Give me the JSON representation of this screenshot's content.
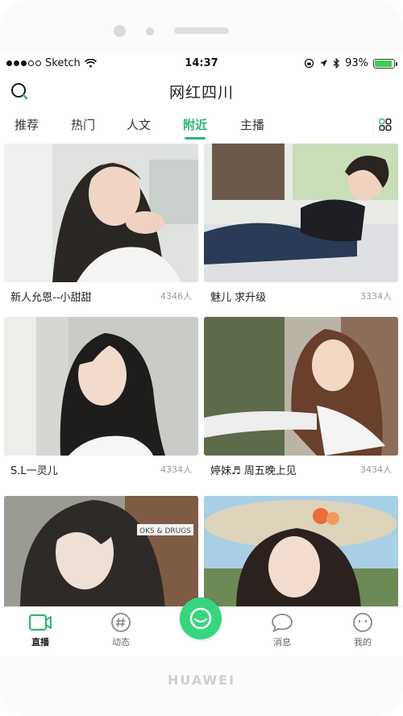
{
  "status_bar": {
    "carrier": "Sketch",
    "time": "14:37",
    "battery_percent": "93%",
    "battery_level": 0.93
  },
  "header": {
    "title": "网红四川"
  },
  "tabs": [
    {
      "label": "推荐",
      "active": false
    },
    {
      "label": "热门",
      "active": false
    },
    {
      "label": "人文",
      "active": false
    },
    {
      "label": "附近",
      "active": true
    },
    {
      "label": "主播",
      "active": false
    }
  ],
  "cards": [
    {
      "name": "新人允恩--小甜甜",
      "count": "4346人"
    },
    {
      "name": "魅儿 求升级",
      "count": "3334人"
    },
    {
      "name": "S.L一灵儿",
      "count": "4334人"
    },
    {
      "name": "婷妹♬ 周五晚上见",
      "count": "3434人"
    },
    {
      "name": "",
      "count": ""
    },
    {
      "name": "",
      "count": ""
    }
  ],
  "photo_overlay_text": "OKS & DRUGS",
  "tabbar": [
    {
      "label": "直播",
      "icon": "video-camera-icon",
      "active": true
    },
    {
      "label": "动态",
      "icon": "hashtag-icon",
      "active": false
    },
    {
      "label": "消息",
      "icon": "chat-bubble-icon",
      "active": false
    },
    {
      "label": "我的",
      "icon": "smiley-face-icon",
      "active": false
    }
  ],
  "device_brand": "HUAWEI",
  "colors": {
    "accent": "#2bb673",
    "center_button": "#36d67e",
    "battery": "#3ad054"
  }
}
